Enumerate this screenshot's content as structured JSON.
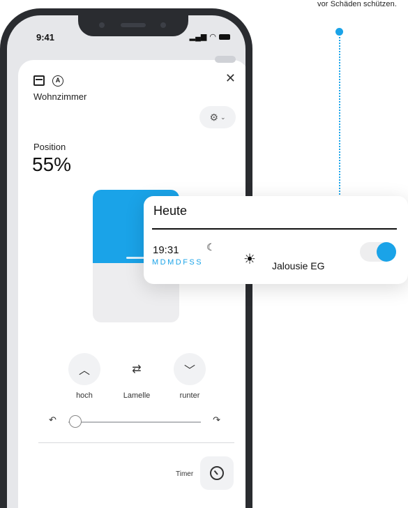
{
  "caption": "vor Schäden schützen.",
  "colors": {
    "accent": "#1aa3e8",
    "phone_frame": "#2a2c30",
    "card_bg": "#ffffff"
  },
  "status_bar": {
    "time": "9:41",
    "icons": [
      "signal-icon",
      "wifi-icon",
      "battery-icon"
    ]
  },
  "header": {
    "room": "Wohnzimmer",
    "icons": [
      "blind-icon",
      "auto-mode-icon",
      "close-icon",
      "gear-icon",
      "chevron-down-icon"
    ]
  },
  "position": {
    "label": "Position",
    "value": "55%",
    "level": 0.55
  },
  "controls": {
    "up": "hoch",
    "slats": "Lamelle",
    "down": "runter"
  },
  "slat_slider": {
    "level": 0.05,
    "left_icon": "slats-open-icon",
    "right_icon": "slats-close-icon"
  },
  "timer": {
    "label": "Timer"
  },
  "schedule_card": {
    "title": "Heute",
    "time": "19:31",
    "days": "MDMDFSS",
    "trigger_icon": "moon-icon",
    "weather_icon": "sun-icon",
    "device": "Jalousie EG",
    "enabled": true
  }
}
